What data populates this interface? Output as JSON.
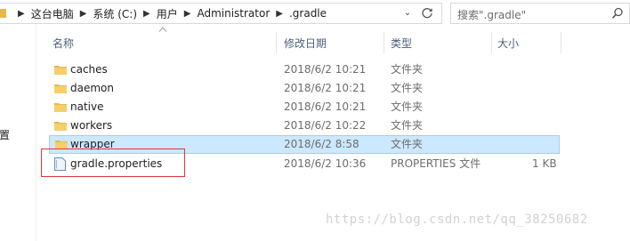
{
  "address_bar": {
    "breadcrumbs": [
      "这台电脑",
      "系统 (C:)",
      "用户",
      "Administrator",
      ".gradle"
    ]
  },
  "search": {
    "placeholder": "搜索\".gradle\""
  },
  "nav": {
    "partial_label": "设置"
  },
  "columns": {
    "name": "名称",
    "date": "修改日期",
    "type": "类型",
    "size": "大小"
  },
  "files": [
    {
      "name": "caches",
      "date": "2018/6/2 10:21",
      "type": "文件夹",
      "size": "",
      "kind": "folder"
    },
    {
      "name": "daemon",
      "date": "2018/6/2 10:21",
      "type": "文件夹",
      "size": "",
      "kind": "folder"
    },
    {
      "name": "native",
      "date": "2018/6/2 10:21",
      "type": "文件夹",
      "size": "",
      "kind": "folder"
    },
    {
      "name": "workers",
      "date": "2018/6/2 10:22",
      "type": "文件夹",
      "size": "",
      "kind": "folder"
    },
    {
      "name": "wrapper",
      "date": "2018/6/2 8:58",
      "type": "文件夹",
      "size": "",
      "kind": "folder",
      "selected": true
    },
    {
      "name": "gradle.properties",
      "date": "2018/6/2 10:36",
      "type": "PROPERTIES 文件",
      "size": "1 KB",
      "kind": "file"
    }
  ],
  "watermark": "https://blog.csdn.net/qq_38250682",
  "colors": {
    "folder": "#e8b84a",
    "selection_bg": "#cce8ff",
    "selection_border": "#99d1ff",
    "header_text": "#4c607a",
    "annotation": "#e0353b"
  }
}
